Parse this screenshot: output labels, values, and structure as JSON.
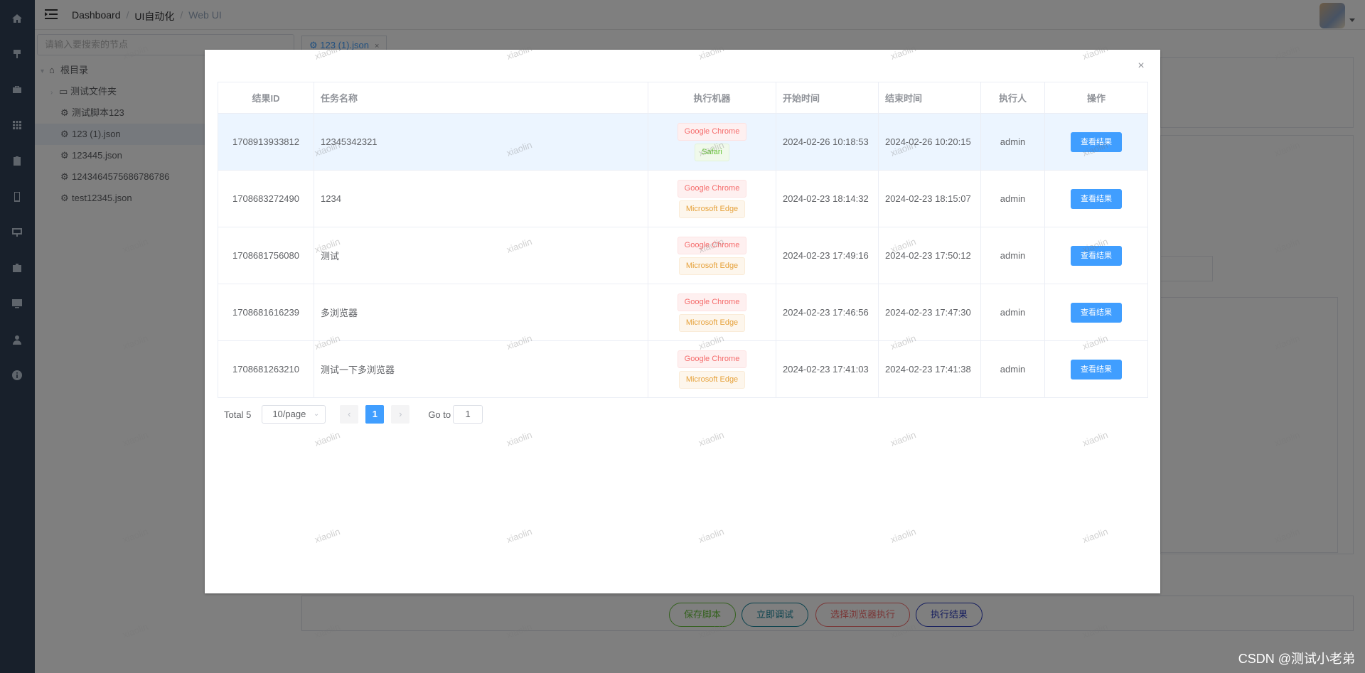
{
  "header": {
    "breadcrumbs": [
      "Dashboard",
      "UI自动化",
      "Web UI"
    ],
    "separator": "/"
  },
  "sidebar": {
    "icons": [
      "home-icon",
      "pin-icon",
      "briefcase-icon",
      "grid-icon",
      "clipboard-icon",
      "tablet-icon",
      "presentation-icon",
      "toolbox-icon",
      "monitor-icon",
      "user-icon",
      "info-icon"
    ]
  },
  "tree": {
    "search_placeholder": "请输入要搜索的节点",
    "root": "根目录",
    "items": [
      {
        "label": "测试文件夹",
        "type": "folder"
      },
      {
        "label": "测试脚本123",
        "type": "file"
      },
      {
        "label": "123 (1).json",
        "type": "file",
        "active": true
      },
      {
        "label": "123445.json",
        "type": "file"
      },
      {
        "label": "1243464575686786786",
        "type": "file"
      },
      {
        "label": "test12345.json",
        "type": "file"
      }
    ]
  },
  "tabs": [
    {
      "label": "123 (1).json",
      "close": "×"
    }
  ],
  "bottom_buttons": {
    "save": "保存脚本",
    "debug": "立即调试",
    "choose_browser": "选择浏览器执行",
    "results": "执行结果"
  },
  "dialog": {
    "close": "×",
    "columns": [
      "结果ID",
      "任务名称",
      "执行机器",
      "开始时间",
      "结束时间",
      "执行人",
      "操作"
    ],
    "rows": [
      {
        "id": "1708913933812",
        "name": "12345342321",
        "machines": [
          "Google Chrome",
          "Safari"
        ],
        "start": "2024-02-26 10:18:53",
        "end": "2024-02-26 10:20:15",
        "user": "admin",
        "action": "查看结果"
      },
      {
        "id": "1708683272490",
        "name": "1234",
        "machines": [
          "Google Chrome",
          "Microsoft Edge"
        ],
        "start": "2024-02-23 18:14:32",
        "end": "2024-02-23 18:15:07",
        "user": "admin",
        "action": "查看结果"
      },
      {
        "id": "1708681756080",
        "name": "测试",
        "machines": [
          "Google Chrome",
          "Microsoft Edge"
        ],
        "start": "2024-02-23 17:49:16",
        "end": "2024-02-23 17:50:12",
        "user": "admin",
        "action": "查看结果"
      },
      {
        "id": "1708681616239",
        "name": "多浏览器",
        "machines": [
          "Google Chrome",
          "Microsoft Edge"
        ],
        "start": "2024-02-23 17:46:56",
        "end": "2024-02-23 17:47:30",
        "user": "admin",
        "action": "查看结果"
      },
      {
        "id": "1708681263210",
        "name": "测试一下多浏览器",
        "machines": [
          "Google Chrome",
          "Microsoft Edge"
        ],
        "start": "2024-02-23 17:41:03",
        "end": "2024-02-23 17:41:38",
        "user": "admin",
        "action": "查看结果"
      }
    ],
    "pagination": {
      "total": "Total 5",
      "page_size": "10/page",
      "current_page": "1",
      "goto_label": "Go to",
      "goto_value": "1"
    }
  },
  "watermark": "xiaolin",
  "csdn_mark": "CSDN @测试小老弟",
  "colors": {
    "sidebar_bg": "#304156",
    "primary": "#409eff",
    "chrome_tag": "#f56c6c",
    "safari_tag": "#67c23a",
    "edge_tag": "#e6a23c"
  }
}
